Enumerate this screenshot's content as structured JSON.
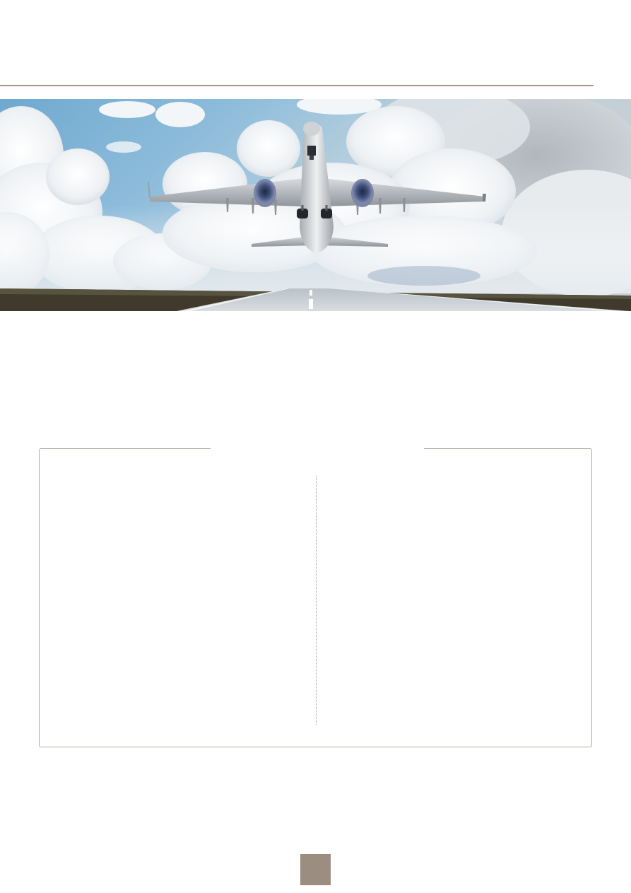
{
  "colors": {
    "accent_taupe": "#9b8d7f",
    "rule": "#a59683",
    "panel_border": "#b5aca2",
    "sky_blue": "#7fb2d4"
  },
  "hero": {
    "image_subject": "airplane-taking-off-over-runway"
  },
  "panel": {
    "title": ""
  },
  "page_number": ""
}
